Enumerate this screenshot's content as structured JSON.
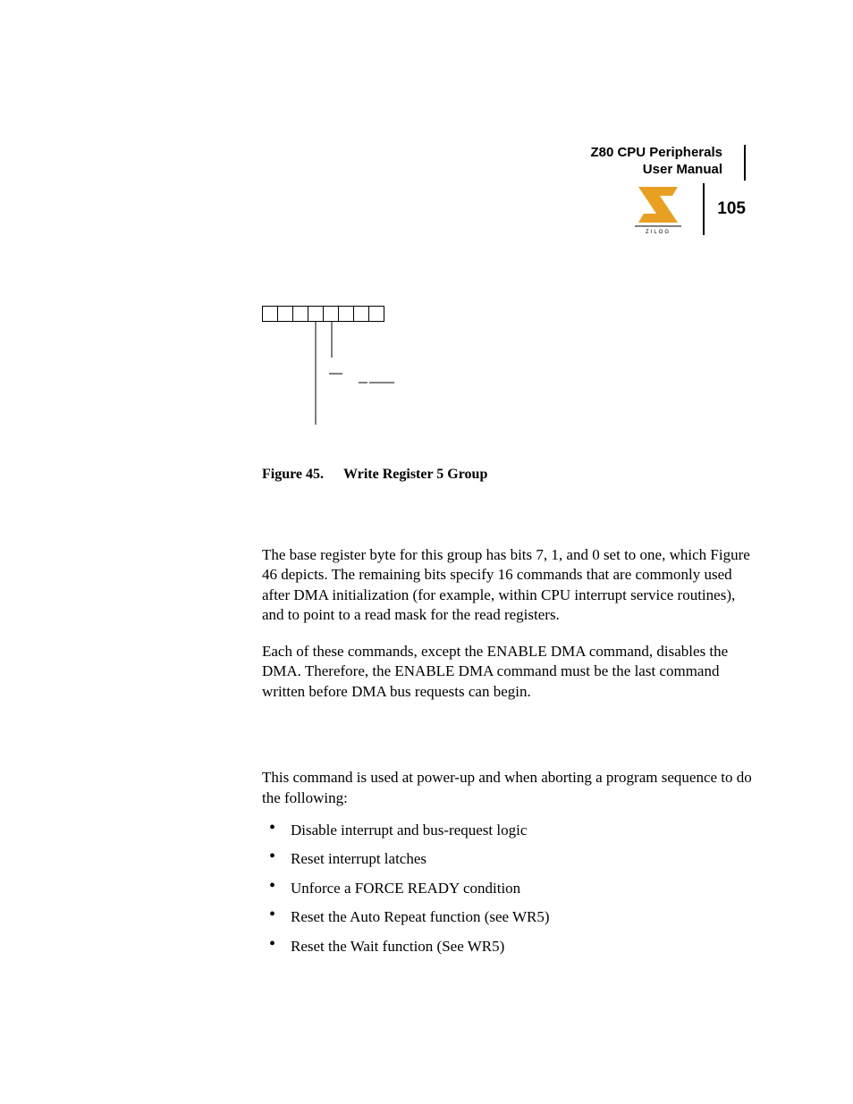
{
  "header": {
    "title_line1": "Z80 CPU Peripherals",
    "title_line2": "User Manual",
    "page_number": "105",
    "logo_text": "ZILOG"
  },
  "figure": {
    "caption_label": "Figure 45.",
    "caption_title": "Write Register 5 Group",
    "bit_count": 8
  },
  "body": {
    "p1": "The base register byte for this group has bits 7, 1, and 0 set to one, which Figure 46 depicts. The remaining bits specify 16 commands that are commonly used after DMA initialization (for example, within CPU interrupt service routines), and to point to a read mask for the read registers.",
    "p2": "Each of these commands, except the ENABLE DMA command, disables the DMA. Therefore, the ENABLE DMA command must be the last command written before DMA bus requests can begin.",
    "p3": "This command is used at power-up and when aborting a program sequence to do the following:",
    "bullets": [
      "Disable interrupt and bus-request logic",
      "Reset interrupt latches",
      "Unforce a FORCE READY condition",
      "Reset the Auto Repeat function (see WR5)",
      "Reset the Wait function (See WR5)"
    ]
  }
}
